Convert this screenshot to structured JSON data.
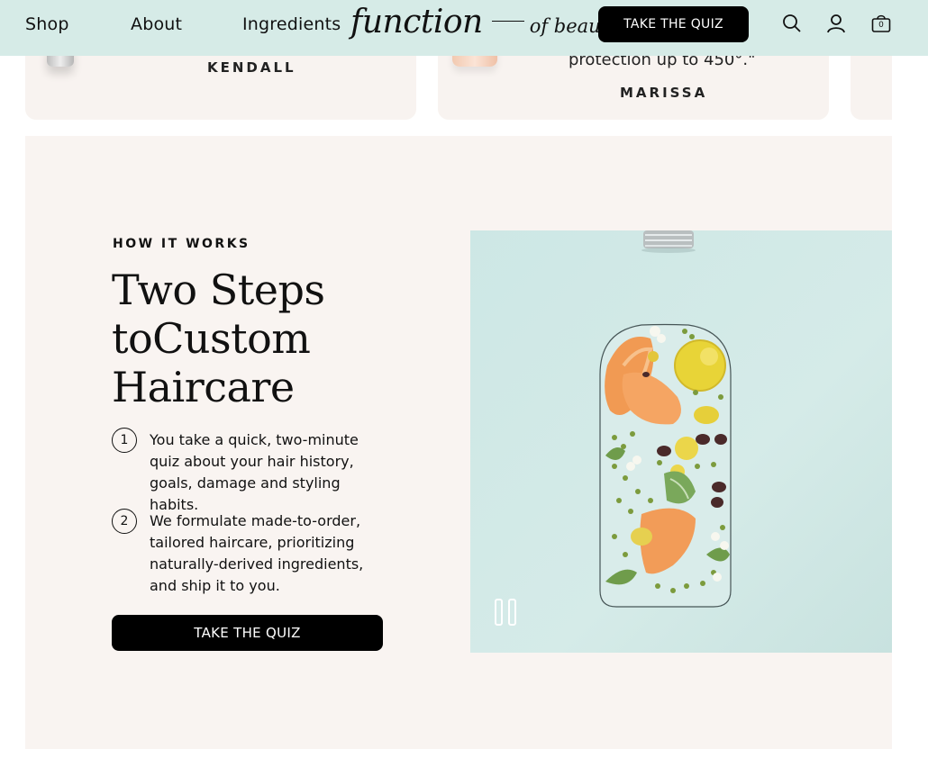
{
  "nav": {
    "links": [
      "Shop",
      "About",
      "Ingredients"
    ],
    "logo_main": "function",
    "logo_sub": "of beauty",
    "quiz_label": "TAKE THE QUIZ",
    "cart_count": "0"
  },
  "reviews": [
    {
      "name": "KENDALL"
    },
    {
      "text_fragment": "protection up to 450°.\"",
      "name": "MARISSA"
    }
  ],
  "how_it_works": {
    "eyebrow": "HOW IT WORKS",
    "headline_line1": "Two Steps",
    "headline_line2": "toCustom",
    "headline_line3": "Haircare",
    "steps": [
      {
        "num": "1",
        "text": "You take a quick, two-minute quiz about your hair history, goals, damage and styling habits."
      },
      {
        "num": "2",
        "text": "We formulate made-to-order, tailored haircare, prioritizing naturally-derived ingredients, and ship it to you."
      }
    ],
    "cta_label": "TAKE THE QUIZ"
  },
  "colors": {
    "nav_bg": "#d6ebe7",
    "section_bg": "#f9f4f1",
    "media_bg": "#cde7e5",
    "button_bg": "#000000"
  }
}
